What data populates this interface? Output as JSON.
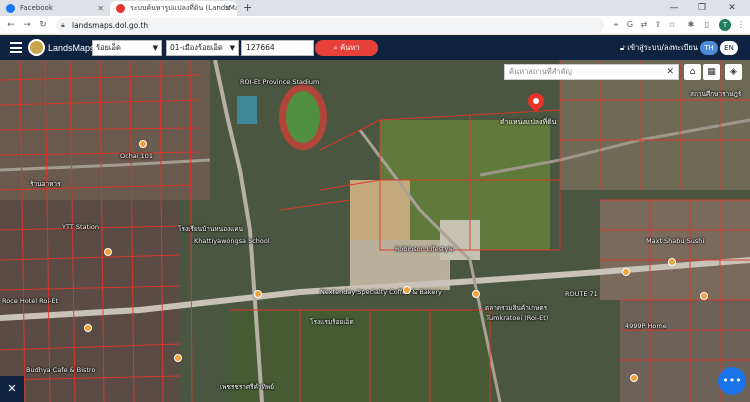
{
  "browser": {
    "tabs": [
      {
        "title": "Facebook",
        "active": false,
        "favicon_color": "#1877f2"
      },
      {
        "title": "ระบบค้นหารูปแปลงที่ดิน (LandsMaps)",
        "active": true,
        "favicon_color": "#e8332c"
      }
    ],
    "new_tab": "+",
    "url": "landsmaps.dol.go.th",
    "profile_initial": "T"
  },
  "header": {
    "brand": "LandsMaps",
    "province": "ร้อยเอ็ด",
    "amphoe": "01-เมืองร้อยเอ็ด",
    "parcel_no": "127664",
    "search_label": "ค้นหา",
    "login_label": "เข้าสู่ระบบ/ลงทะเบียน",
    "lang_th": "TH",
    "lang_en": "EN"
  },
  "map": {
    "place_search_placeholder": "ค้นหาสถานที่สำคัญ",
    "pin_label": "ตำแหน่งแปลงที่ดิน",
    "labels": [
      "ROI-Et Province Stadium",
      "Ochai 101",
      "ร้านอาหาร",
      "YTT Station",
      "โรงเรียนบ้านหนองแคน",
      "Khattiyawongsa School",
      "Roce Hotel Roi-Et",
      "Nextenday Specialty Coffee & Bakery",
      "Robinson Lifestyle",
      "โรงแรมร้อยเอ็ด",
      "ตลาดรวมสินค้าเกษตร",
      "Maxt Shabu Sushi",
      "Tumkratoei (Roi-Et)",
      "Budhya Cafe & Bistro",
      "ROUTE 71",
      "4999P Home",
      "เพชรชราศรีคำทิพย์",
      "สถานศึกษาราษฎร์"
    ]
  },
  "colors": {
    "header_bg": "#0f2340",
    "search_button": "#e8413a",
    "pin": "#e8332c",
    "fab": "#1a73e8"
  }
}
